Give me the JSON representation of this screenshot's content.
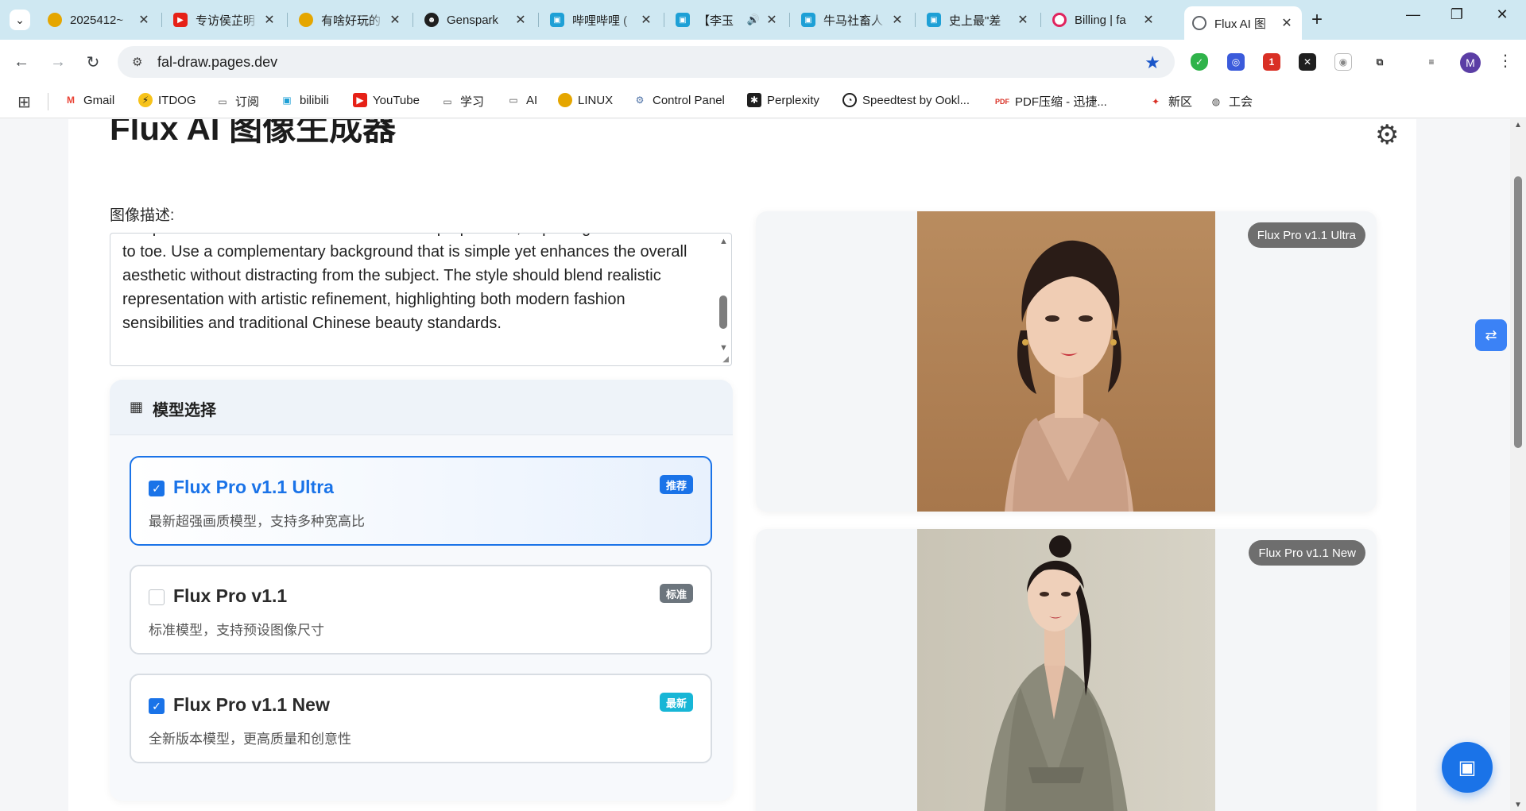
{
  "browser": {
    "tabs": [
      {
        "title": "2025412~",
        "favicon_color": "#e5a600"
      },
      {
        "title": "专访侯芷明",
        "favicon_color": "#e62117"
      },
      {
        "title": "有啥好玩的",
        "favicon_color": "#e5a600"
      },
      {
        "title": "Genspark",
        "favicon_color": "#1f1f1f"
      },
      {
        "title": "哔哩哔哩 (",
        "favicon_color": "#1ea0d6"
      },
      {
        "title": "【李玉",
        "favicon_color": "#1ea0d6"
      },
      {
        "title": "牛马社畜人",
        "favicon_color": "#1ea0d6"
      },
      {
        "title": "史上最\"差",
        "favicon_color": "#1ea0d6"
      },
      {
        "title": "Billing | fa",
        "favicon_color": "#e0245e"
      },
      {
        "title": "Flux AI 图",
        "favicon_color": "#5f6368",
        "active": true
      }
    ],
    "new_tab_label": "+",
    "url": "fal-draw.pages.dev",
    "profile_initial": "M",
    "bookmarks": [
      {
        "label": "Gmail",
        "icon": "gmail-icon"
      },
      {
        "label": "ITDOG",
        "icon": "itdog-icon"
      },
      {
        "label": "订阅",
        "icon": "folder-icon"
      },
      {
        "label": "bilibili",
        "icon": "bilibili-icon"
      },
      {
        "label": "YouTube",
        "icon": "youtube-icon"
      },
      {
        "label": "学习",
        "icon": "folder-icon"
      },
      {
        "label": "AI",
        "icon": "folder-icon"
      },
      {
        "label": "LINUX",
        "icon": "linux-icon"
      },
      {
        "label": "Control Panel",
        "icon": "control-panel-icon"
      },
      {
        "label": "Perplexity",
        "icon": "perplexity-icon"
      },
      {
        "label": "Speedtest by Ookl...",
        "icon": "speedtest-icon"
      },
      {
        "label": "PDF压缩 - 迅捷...",
        "icon": "pdf-icon"
      },
      {
        "label": "新区",
        "icon": "xinqu-icon"
      },
      {
        "label": "工会",
        "icon": "globe-icon"
      }
    ]
  },
  "app": {
    "heading": "Flux AI 图像生成器",
    "description_label": "图像描述:",
    "description_text": "composition should be artistic with balanced proportions, capturing her from head to toe. Use a complementary background that is simple yet enhances the overall aesthetic without distracting from the subject. The style should blend realistic representation with artistic refinement, highlighting both modern fashion sensibilities and traditional Chinese beauty standards.",
    "model_section_title": "模型选择",
    "models": [
      {
        "name": "Flux Pro v1.1 Ultra",
        "description": "最新超强画质模型，支持多种宽高比",
        "badge": "推荐",
        "badge_color": "#1a73e8",
        "checked": true,
        "selected": true
      },
      {
        "name": "Flux Pro v1.1",
        "description": "标准模型，支持预设图像尺寸",
        "badge": "标准",
        "badge_color": "#6c757d",
        "checked": false,
        "selected": false
      },
      {
        "name": "Flux Pro v1.1 New",
        "description": "全新版本模型，更高质量和创意性",
        "badge": "最新",
        "badge_color": "#17b6d6",
        "checked": true,
        "selected": false
      }
    ],
    "results": [
      {
        "label": "Flux Pro v1.1 Ultra"
      },
      {
        "label": "Flux Pro v1.1 New"
      }
    ]
  }
}
